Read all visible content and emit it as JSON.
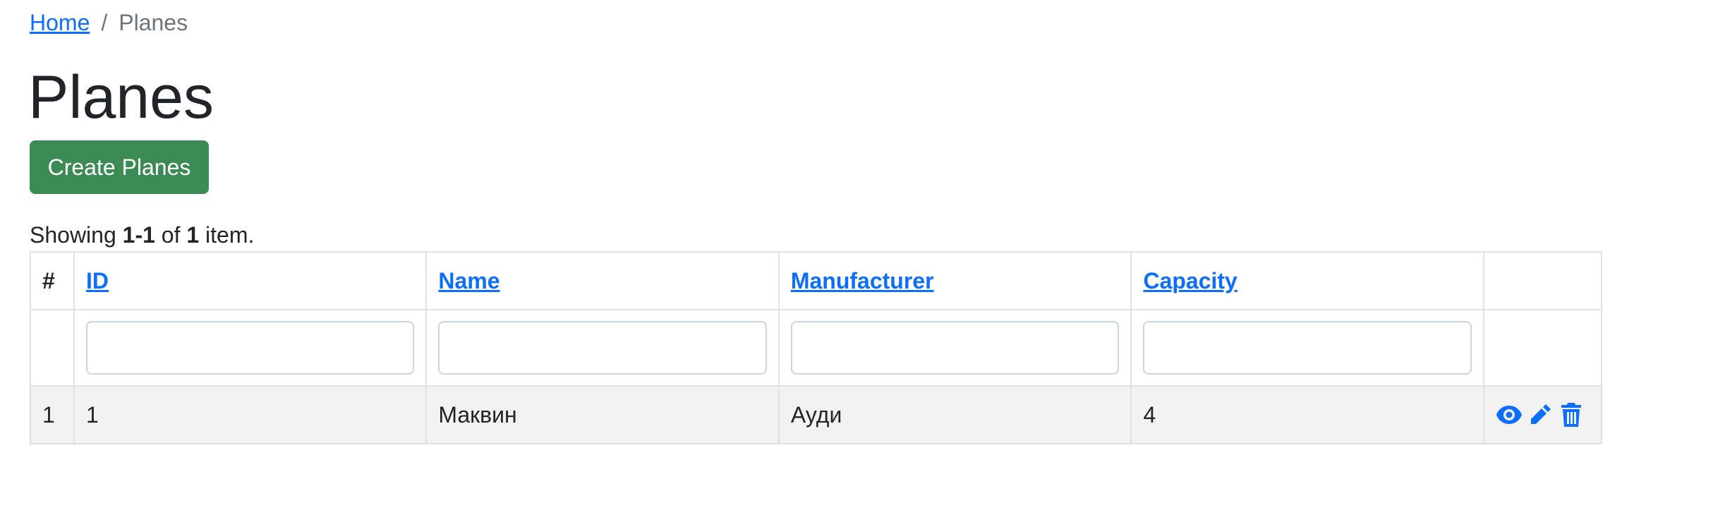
{
  "breadcrumb": {
    "home": "Home",
    "separator": "/",
    "current": "Planes"
  },
  "page_title": "Planes",
  "create_button": "Create Planes",
  "summary": {
    "prefix": "Showing ",
    "range": "1-1",
    "of": " of ",
    "total": "1",
    "suffix": " item."
  },
  "table": {
    "headers": {
      "serial": "#",
      "id": "ID",
      "name": "Name",
      "manufacturer": "Manufacturer",
      "capacity": "Capacity"
    },
    "filters": {
      "id": "",
      "name": "",
      "manufacturer": "",
      "capacity": ""
    },
    "rows": [
      {
        "serial": "1",
        "id": "1",
        "name": "Маквин",
        "manufacturer": "Ауди",
        "capacity": "4",
        "actions": [
          "eye-icon",
          "pencil-icon",
          "trash-icon"
        ]
      }
    ]
  },
  "colors": {
    "link": "#0d6efd",
    "create_button_bg": "#3d8b54",
    "row_bg": "#f2f2f2",
    "border": "#dee2e6"
  }
}
